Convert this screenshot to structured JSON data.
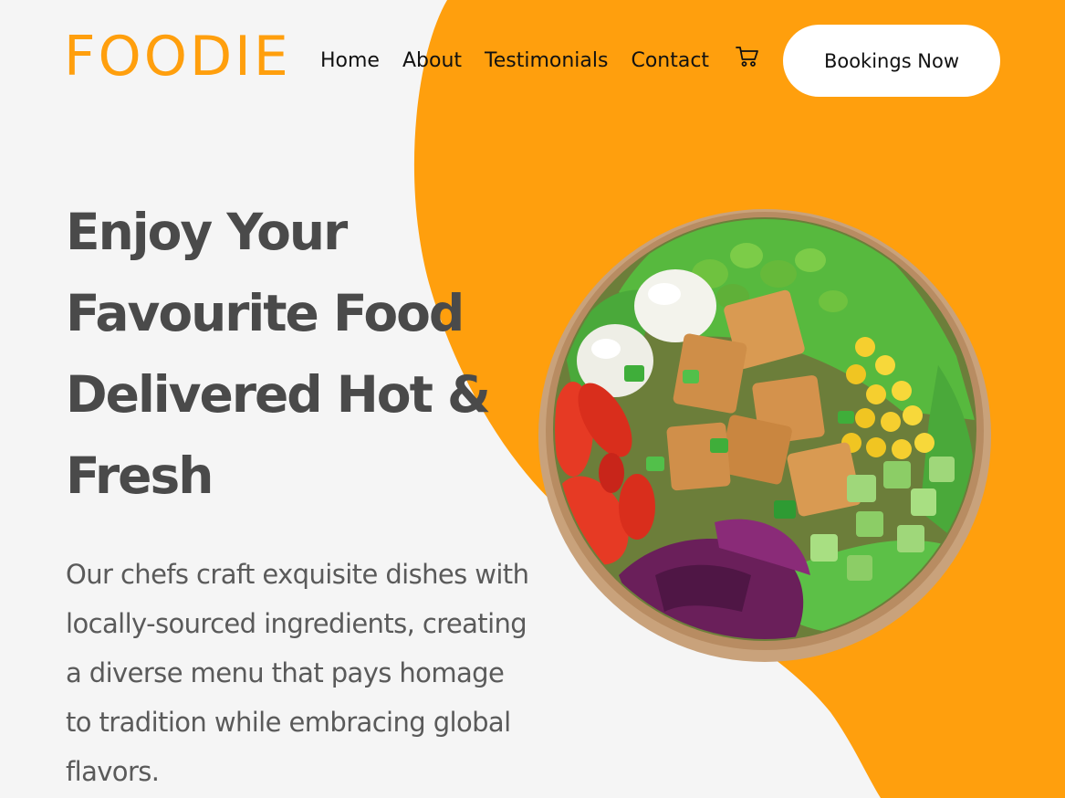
{
  "brand": {
    "logo_text": "FOODIE"
  },
  "nav": {
    "items": [
      {
        "label": "Home"
      },
      {
        "label": "About"
      },
      {
        "label": "Testimonials"
      },
      {
        "label": "Contact"
      }
    ],
    "cart_icon": "cart-icon",
    "cta_label": "Bookings Now"
  },
  "hero": {
    "title_lines": [
      "Enjoy Your",
      "Favourite Food",
      "Delivered Hot &",
      "Fresh"
    ],
    "description": "Our chefs craft exquisite dishes with locally-sourced ingredients, creating a diverse menu that pays homage to tradition while embracing global flavors."
  },
  "colors": {
    "accent": "#ff9f0d",
    "background": "#f5f5f5",
    "heading": "#4a4a4a",
    "body_text": "#5a5a5a",
    "button_bg": "#ffffff"
  }
}
